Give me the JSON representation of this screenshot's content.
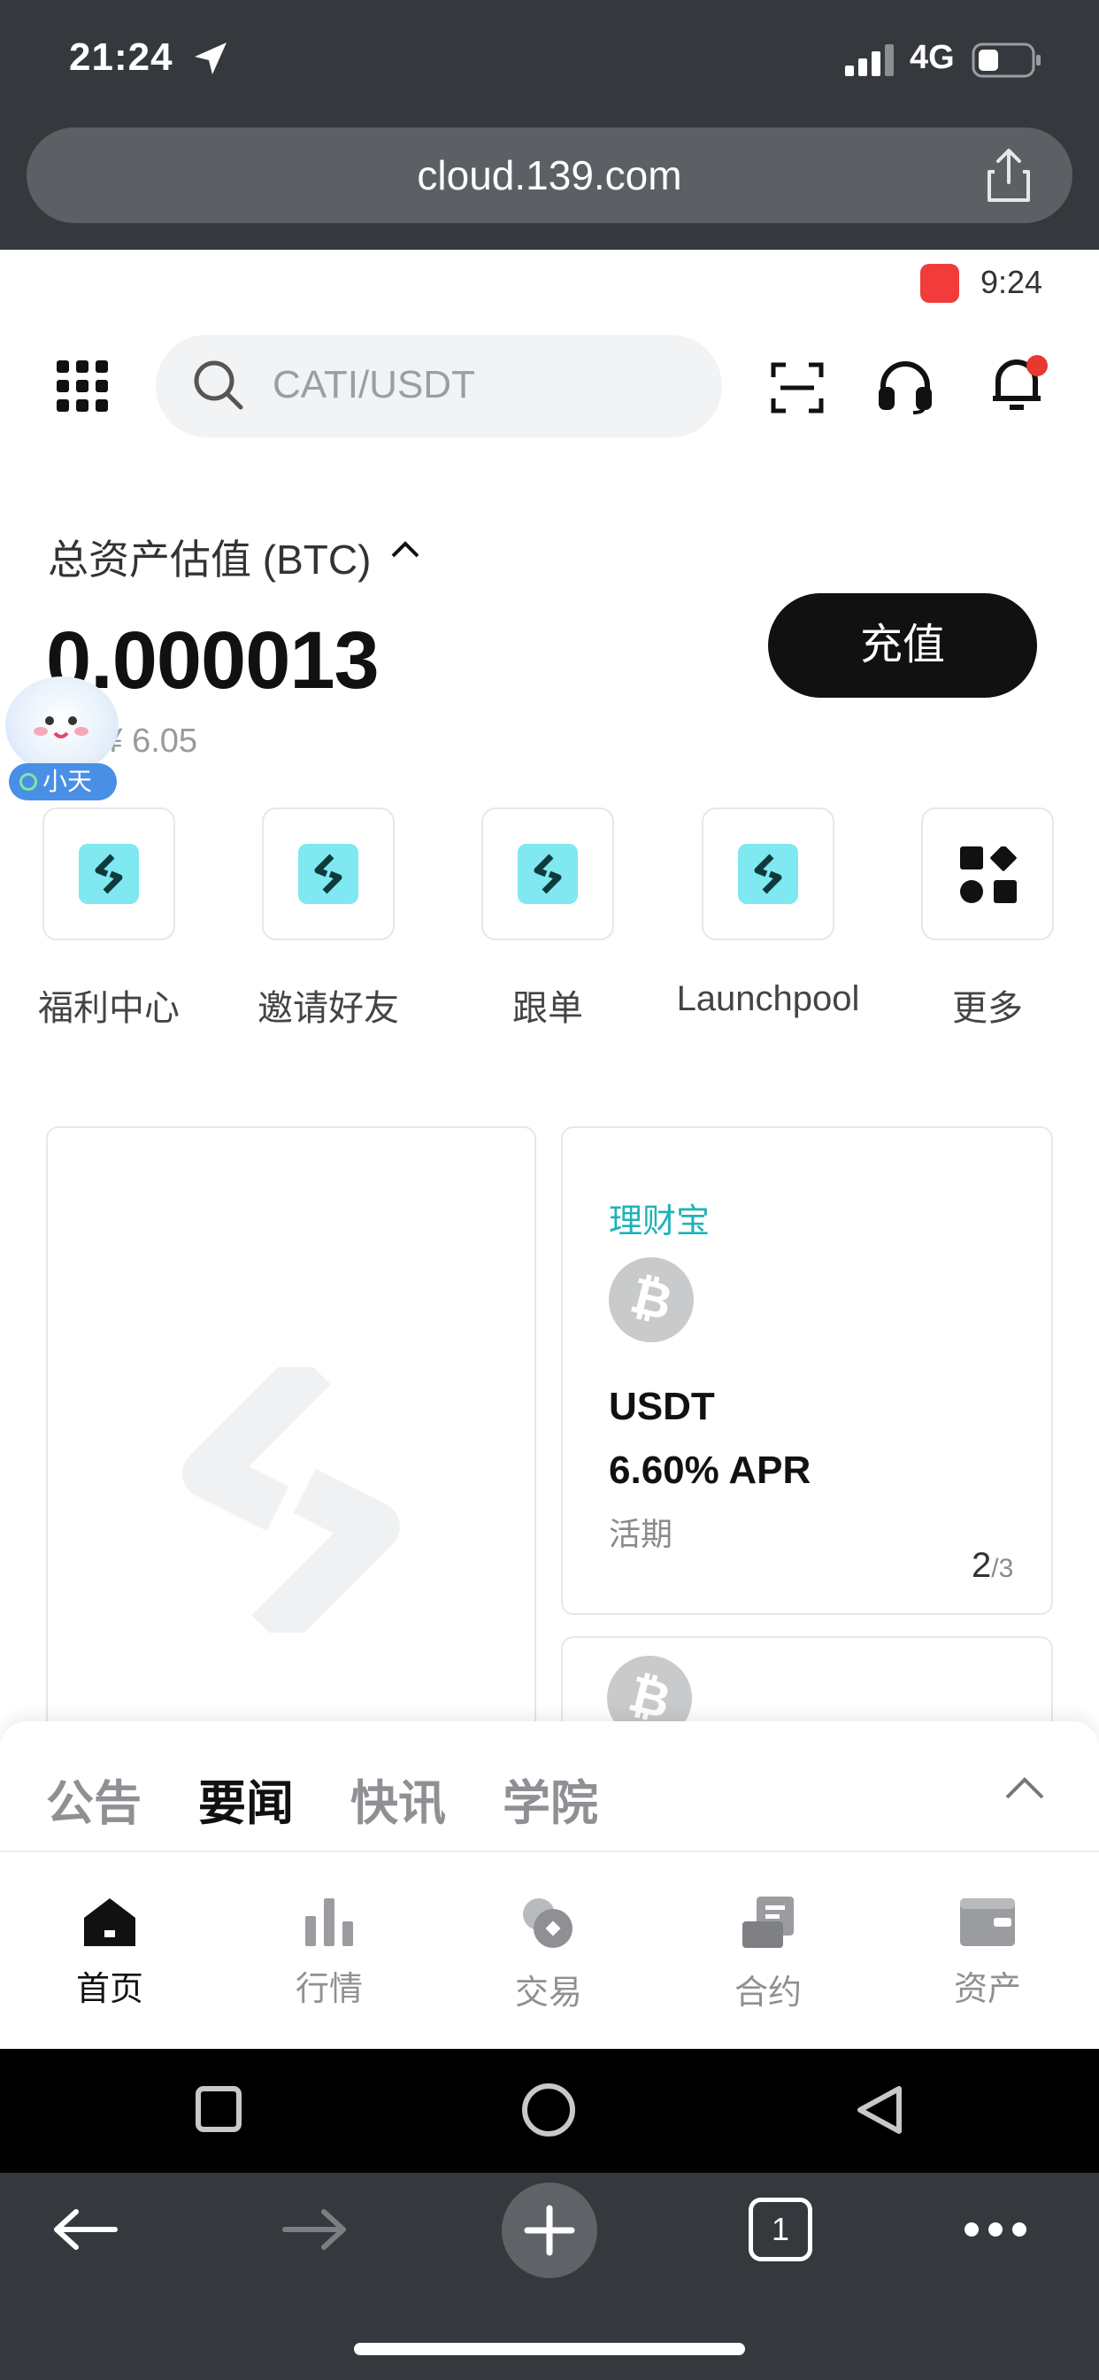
{
  "ios": {
    "time": "21:24",
    "network": "4G"
  },
  "browser": {
    "url": "cloud.139.com",
    "tab_count": "1"
  },
  "page_status": {
    "clock": "9:24"
  },
  "search": {
    "placeholder": "CATI/USDT"
  },
  "asset": {
    "label": "总资产估值 (BTC)",
    "value": "0.000013",
    "fiat": "≈ ¥ 6.05",
    "deposit_label": "充值"
  },
  "mascot": {
    "label": "小天"
  },
  "quick_actions": [
    {
      "label": "福利中心",
      "icon": "bitget-logo-icon"
    },
    {
      "label": "邀请好友",
      "icon": "bitget-logo-icon"
    },
    {
      "label": "跟单",
      "icon": "bitget-logo-icon"
    },
    {
      "label": "Launchpool",
      "icon": "bitget-logo-icon"
    },
    {
      "label": "更多",
      "icon": "shapes-icon"
    }
  ],
  "finance_card": {
    "title": "理财宝",
    "coin": "USDT",
    "apr": "6.60% APR",
    "type": "活期",
    "page_current": "2",
    "page_total": "/3"
  },
  "news_tabs": [
    {
      "label": "公告",
      "active": false
    },
    {
      "label": "要闻",
      "active": true
    },
    {
      "label": "快讯",
      "active": false
    },
    {
      "label": "学院",
      "active": false
    }
  ],
  "bottom_nav": [
    {
      "label": "首页",
      "icon": "home-icon",
      "active": true
    },
    {
      "label": "行情",
      "icon": "bar-chart-icon",
      "active": false
    },
    {
      "label": "交易",
      "icon": "trade-icon",
      "active": false
    },
    {
      "label": "合约",
      "icon": "contract-icon",
      "active": false
    },
    {
      "label": "资产",
      "icon": "wallet-icon",
      "active": false
    }
  ],
  "colors": {
    "accent_teal": "#1fb3b8",
    "notification_red": "#e8392f",
    "chrome_dark": "#35383c"
  }
}
